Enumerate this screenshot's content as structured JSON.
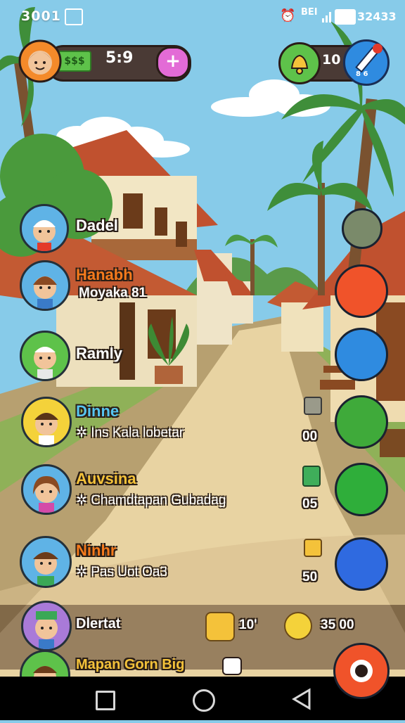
{
  "status_bar": {
    "time": "3001",
    "battery": "32433",
    "signal_label": "BEI"
  },
  "hud": {
    "cash_label": "$$$",
    "count": "5:9",
    "plus_label": "+",
    "notifications": "10",
    "edit_sub": "8 6"
  },
  "friends": [
    {
      "name": "Dadel",
      "sub": "",
      "score": ""
    },
    {
      "name": "Hanabh",
      "sub": "Moyaka 81",
      "score": ""
    },
    {
      "name": "Ramly",
      "sub": "",
      "score": ""
    },
    {
      "name": "Dinne",
      "sub": "Ins Kala lobetar",
      "score": "00"
    },
    {
      "name": "Auvsina",
      "sub": "Chamdtapan Gubadag",
      "score": "05"
    },
    {
      "name": "Ninhr",
      "sub": "Pas Uot Oa3",
      "score": "50"
    },
    {
      "name": "Dlertat",
      "sub": "",
      "score": ""
    },
    {
      "name": "Mapan Gorn Big",
      "sub": "",
      "score": ""
    }
  ],
  "bottom_bar": {
    "left_count": "10'",
    "right_count": "35 00"
  },
  "colors": {
    "sky": "#87cbe9",
    "road": "#e8d3a2",
    "accent_green": "#5ec24a",
    "accent_pink": "#e36bd6",
    "accent_orange": "#f57a1c"
  },
  "icons": {
    "notification": "bell-icon",
    "edit": "pencil-icon",
    "nav": [
      "square-icon",
      "circle-icon",
      "back-triangle-icon"
    ]
  }
}
